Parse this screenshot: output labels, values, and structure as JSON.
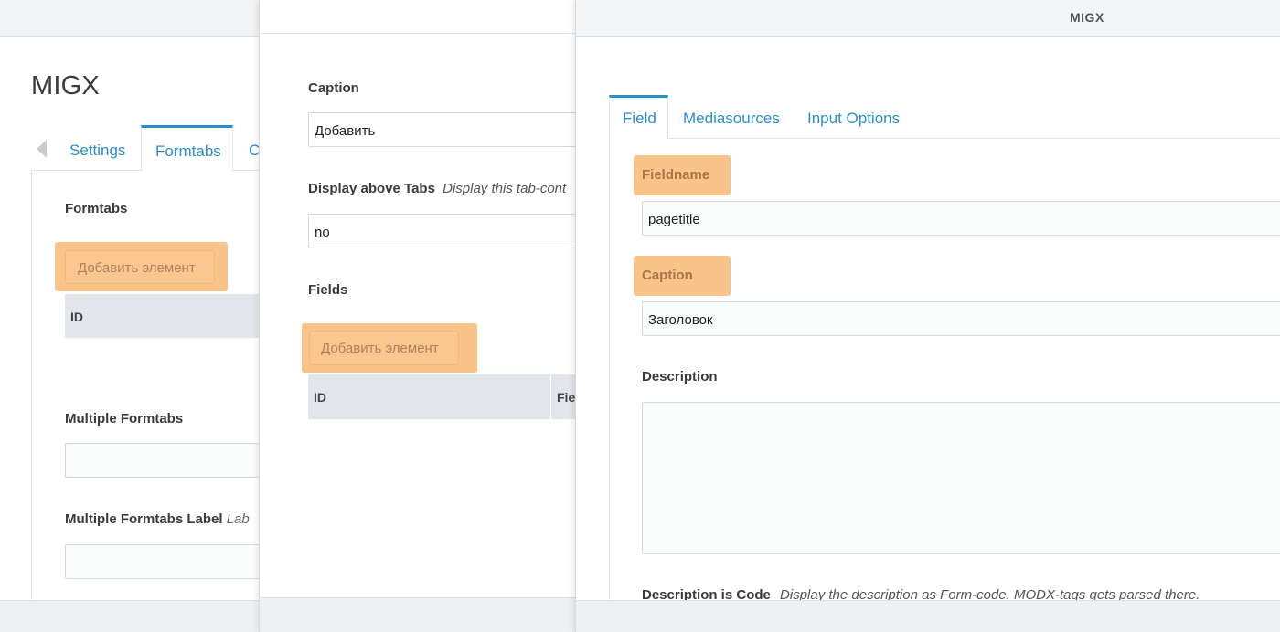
{
  "panel1": {
    "title": "MIGX",
    "tabs": [
      "Settings",
      "Formtabs",
      "C"
    ],
    "section_formtabs": "Formtabs",
    "add_button": "Добавить элемент",
    "grid_col_id": "ID",
    "multiple_formtabs": "Multiple Formtabs",
    "multiple_formtabs_label": "Multiple Formtabs Label",
    "multiple_formtabs_label_hint": "Lab"
  },
  "panel2": {
    "caption_label": "Caption",
    "caption_value": "Добавить",
    "display_above_label": "Display above Tabs",
    "display_above_hint": "Display this tab-cont",
    "display_above_value": "no",
    "fields_label": "Fields",
    "add_button": "Добавить элемент",
    "grid_col_id": "ID",
    "grid_col_field": "Fie"
  },
  "panel3": {
    "window_title": "MIGX",
    "tabs": [
      "Field",
      "Mediasources",
      "Input Options"
    ],
    "fieldname_label": "Fieldname",
    "fieldname_value": "pagetitle",
    "caption_label": "Caption",
    "caption_value": "Заголовок",
    "description_label": "Description",
    "description_value": "",
    "description_is_code_label": "Description is Code",
    "description_is_code_hint": "Display the description as Form-code. MODX-tags gets parsed there."
  },
  "colors": {
    "accent": "#2a8fc9",
    "highlight": "#f9c48a",
    "grid_header": "#e2e6ea"
  }
}
